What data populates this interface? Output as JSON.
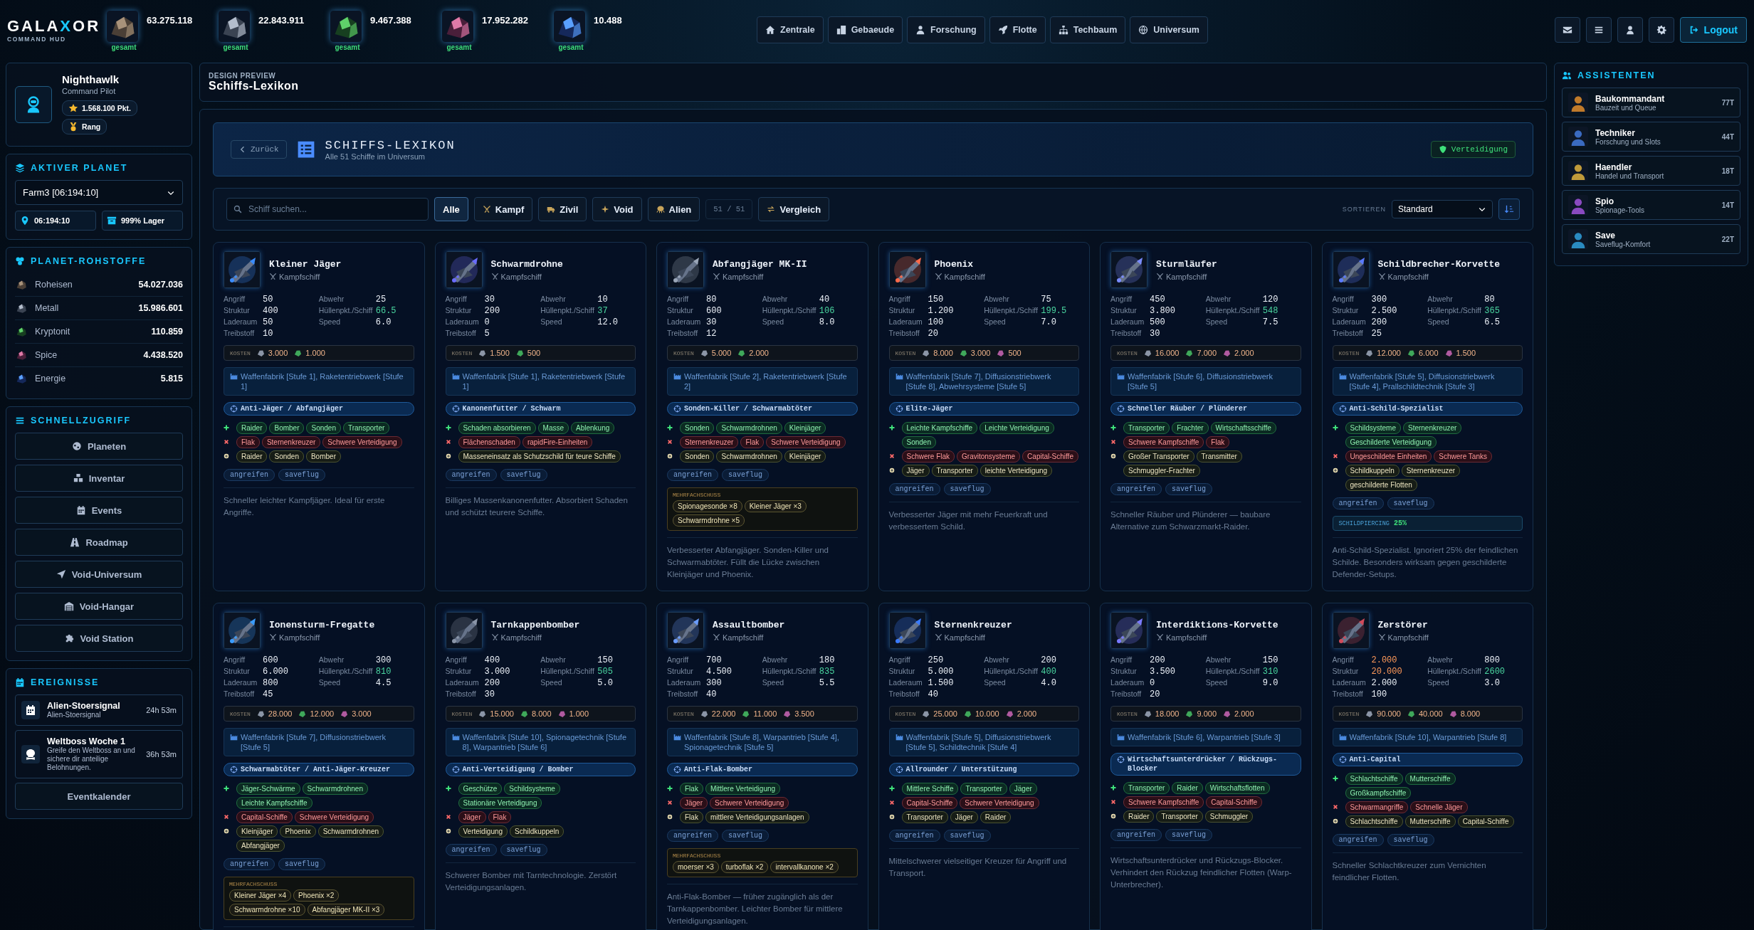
{
  "header": {
    "logo": {
      "before": "GALA",
      "accent": "X",
      "after": "OR",
      "subtitle": "COMMAND HUD"
    },
    "resources": [
      {
        "kind": "roheisen",
        "value": "63.275.118",
        "label": "gesamt"
      },
      {
        "kind": "metall",
        "value": "22.843.911",
        "label": "gesamt"
      },
      {
        "kind": "kryptonit",
        "value": "9.467.388",
        "label": "gesamt"
      },
      {
        "kind": "spice",
        "value": "17.952.282",
        "label": "gesamt"
      },
      {
        "kind": "energie",
        "value": "10.488",
        "label": "gesamt"
      }
    ],
    "nav": [
      "Zentrale",
      "Gebaeude",
      "Forschung",
      "Flotte",
      "Techbaum",
      "Universum"
    ],
    "logout": "Logout"
  },
  "profile": {
    "name": "Nighthawlk",
    "role": "Command Pilot",
    "points": "1.568.100 Pkt.",
    "rank": "Rang"
  },
  "active_planet": {
    "title": "AKTIVER PLANET",
    "selected": "Farm3 [06:194:10]",
    "coords": "06:194:10",
    "storage": "999% Lager"
  },
  "planet_resources": {
    "title": "PLANET-ROHSTOFFE",
    "items": [
      {
        "kind": "roheisen",
        "name": "Roheisen",
        "value": "54.027.036"
      },
      {
        "kind": "metall",
        "name": "Metall",
        "value": "15.986.601"
      },
      {
        "kind": "kryptonit",
        "name": "Kryptonit",
        "value": "110.859"
      },
      {
        "kind": "spice",
        "name": "Spice",
        "value": "4.438.520"
      },
      {
        "kind": "energie",
        "name": "Energie",
        "value": "5.815"
      }
    ]
  },
  "quick_access": {
    "title": "SCHNELLZUGRIFF",
    "items": [
      "Planeten",
      "Inventar",
      "Events",
      "Roadmap",
      "Void-Universum",
      "Void-Hangar",
      "Void Station"
    ]
  },
  "events": {
    "title": "EREIGNISSE",
    "items": [
      {
        "kind": "signal",
        "title": "Alien-Stoersignal",
        "text": "Alien-Stoersignal",
        "time": "24h 53m"
      },
      {
        "kind": "boss",
        "title": "Weltboss Woche 1",
        "text": "Greife den Weltboss an und sichere dir anteilige Belohnungen.",
        "time": "36h 53m"
      }
    ],
    "button": "Eventkalender"
  },
  "page": {
    "eyebrow": "DESIGN PREVIEW",
    "title": "Schiffs-Lexikon"
  },
  "lexikon": {
    "back": "Zurück",
    "title": "SCHIFFS-LEXIKON",
    "subtitle": "Alle 51 Schiffe im Universum",
    "badge": "Verteidigung"
  },
  "filters": {
    "search": {
      "placeholder": "Schiff suchen..."
    },
    "buttons": [
      {
        "label": "Alle",
        "selected": true
      },
      {
        "label": "Kampf",
        "selected": false
      },
      {
        "label": "Zivil",
        "selected": false
      },
      {
        "label": "Void",
        "selected": false
      },
      {
        "label": "Alien",
        "selected": false
      }
    ],
    "count": "51 / 51",
    "compare": "Vergleich",
    "sort_label": "SORTIEREN",
    "sort": "Standard"
  },
  "ships": [
    {
      "name": "Kleiner Jäger",
      "type": "Kampfschiff",
      "stats": [
        {
          "label": "Angriff",
          "value": "50"
        },
        {
          "label": "Abwehr",
          "value": "25"
        },
        {
          "label": "Struktur",
          "value": "400"
        },
        {
          "label": "Hüllenpkt./Schiff",
          "value": "66.5",
          "kind": "hull"
        },
        {
          "label": "Laderaum",
          "value": "50"
        },
        {
          "label": "Speed",
          "value": "6.0"
        },
        {
          "label": "Treibstoff",
          "value": "10"
        }
      ],
      "cost_label": "KOSTEN",
      "costs": [
        {
          "kind": "ore",
          "value": "3.000"
        },
        {
          "kind": "crystal",
          "value": "1.000"
        }
      ],
      "requirement": "Waffenfabrik [Stufe 1], Raketentriebwerk [Stufe 1]",
      "role": "Anti-Jäger / Abfangjäger",
      "matchups": [
        {
          "kind": "strong",
          "tags": [
            "Raider",
            "Bomber",
            "Sonden",
            "Transporter"
          ]
        },
        {
          "kind": "weak",
          "tags": [
            "Flak",
            "Sternenkreuzer",
            "Schwere Verteidigung"
          ]
        },
        {
          "kind": "target",
          "tags": [
            "Raider",
            "Sonden",
            "Bomber"
          ]
        }
      ],
      "missions": [
        "angreifen",
        "saveflug"
      ],
      "description": "Schneller leichter Kampfjäger. Ideal für erste Angriffe."
    },
    {
      "name": "Schwarmdrohne",
      "type": "Kampfschiff",
      "stats": [
        {
          "label": "Angriff",
          "value": "30"
        },
        {
          "label": "Abwehr",
          "value": "10"
        },
        {
          "label": "Struktur",
          "value": "200"
        },
        {
          "label": "Hüllenpkt./Schiff",
          "value": "37",
          "kind": "hull"
        },
        {
          "label": "Laderaum",
          "value": "0"
        },
        {
          "label": "Speed",
          "value": "12.0"
        },
        {
          "label": "Treibstoff",
          "value": "5"
        }
      ],
      "cost_label": "KOSTEN",
      "costs": [
        {
          "kind": "ore",
          "value": "1.500"
        },
        {
          "kind": "crystal",
          "value": "500"
        }
      ],
      "requirement": "Waffenfabrik [Stufe 1], Raketentriebwerk [Stufe 1]",
      "role": "Kanonenfutter / Schwarm",
      "matchups": [
        {
          "kind": "strong",
          "tags": [
            "Schaden absorbieren",
            "Masse",
            "Ablenkung"
          ]
        },
        {
          "kind": "weak",
          "tags": [
            "Flächenschaden",
            "rapidFire-Einheiten"
          ]
        },
        {
          "kind": "target",
          "tags": [
            "Masseneinsatz als Schutzschild für teure Schiffe"
          ]
        }
      ],
      "missions": [
        "angreifen",
        "saveflug"
      ],
      "description": "Billiges Massenkanonenfutter. Absorbiert Schaden und schützt teurere Schiffe."
    },
    {
      "name": "Abfangjäger MK-II",
      "type": "Kampfschiff",
      "stats": [
        {
          "label": "Angriff",
          "value": "80"
        },
        {
          "label": "Abwehr",
          "value": "40"
        },
        {
          "label": "Struktur",
          "value": "600"
        },
        {
          "label": "Hüllenpkt./Schiff",
          "value": "106",
          "kind": "hull"
        },
        {
          "label": "Laderaum",
          "value": "30"
        },
        {
          "label": "Speed",
          "value": "8.0"
        },
        {
          "label": "Treibstoff",
          "value": "12"
        }
      ],
      "cost_label": "KOSTEN",
      "costs": [
        {
          "kind": "ore",
          "value": "5.000"
        },
        {
          "kind": "crystal",
          "value": "2.000"
        }
      ],
      "requirement": "Waffenfabrik [Stufe 2], Raketentriebwerk [Stufe 2]",
      "role": "Sonden-Killer / Schwarmabtöter",
      "matchups": [
        {
          "kind": "strong",
          "tags": [
            "Sonden",
            "Schwarmdrohnen",
            "Kleinjäger"
          ]
        },
        {
          "kind": "weak",
          "tags": [
            "Sternenkreuzer",
            "Flak",
            "Schwere Verteidigung"
          ]
        },
        {
          "kind": "target",
          "tags": [
            "Sonden",
            "Schwarmdrohnen",
            "Kleinjäger"
          ]
        }
      ],
      "missions": [
        "angreifen",
        "saveflug"
      ],
      "multishot": {
        "label": "MEHRFACHSCHUSS",
        "items": [
          "Spionagesonde ×8",
          "Kleiner Jäger ×3",
          "Schwarmdrohne ×5"
        ]
      },
      "description": "Verbesserter Abfangjäger. Sonden-Killer und Schwarmabtöter. Füllt die Lücke zwischen Kleinjäger und Phoenix."
    },
    {
      "name": "Phoenix",
      "type": "Kampfschiff",
      "stats": [
        {
          "label": "Angriff",
          "value": "150"
        },
        {
          "label": "Abwehr",
          "value": "75"
        },
        {
          "label": "Struktur",
          "value": "1.200"
        },
        {
          "label": "Hüllenpkt./Schiff",
          "value": "199.5",
          "kind": "hull"
        },
        {
          "label": "Laderaum",
          "value": "100"
        },
        {
          "label": "Speed",
          "value": "7.0"
        },
        {
          "label": "Treibstoff",
          "value": "20"
        }
      ],
      "cost_label": "KOSTEN",
      "costs": [
        {
          "kind": "ore",
          "value": "8.000"
        },
        {
          "kind": "crystal",
          "value": "3.000"
        },
        {
          "kind": "spice",
          "value": "500"
        }
      ],
      "requirement": "Waffenfabrik [Stufe 7], Diffusionstriebwerk [Stufe 8], Abwehrsysteme [Stufe 5]",
      "role": "Elite-Jäger",
      "matchups": [
        {
          "kind": "strong",
          "tags": [
            "Leichte Kampfschiffe",
            "Leichte Verteidigung",
            "Sonden"
          ]
        },
        {
          "kind": "weak",
          "tags": [
            "Schwere Flak",
            "Gravitonsysteme",
            "Capital-Schiffe"
          ]
        },
        {
          "kind": "target",
          "tags": [
            "Jäger",
            "Transporter",
            "leichte Verteidigung"
          ]
        }
      ],
      "missions": [
        "angreifen",
        "saveflug"
      ],
      "description": "Verbesserter Jäger mit mehr Feuerkraft und verbessertem Schild."
    },
    {
      "name": "Sturmläufer",
      "type": "Kampfschiff",
      "stats": [
        {
          "label": "Angriff",
          "value": "450"
        },
        {
          "label": "Abwehr",
          "value": "120"
        },
        {
          "label": "Struktur",
          "value": "3.800"
        },
        {
          "label": "Hüllenpkt./Schiff",
          "value": "548",
          "kind": "hull"
        },
        {
          "label": "Laderaum",
          "value": "500"
        },
        {
          "label": "Speed",
          "value": "7.5"
        },
        {
          "label": "Treibstoff",
          "value": "30"
        }
      ],
      "cost_label": "KOSTEN",
      "costs": [
        {
          "kind": "ore",
          "value": "16.000"
        },
        {
          "kind": "crystal",
          "value": "7.000"
        },
        {
          "kind": "spice",
          "value": "2.000"
        }
      ],
      "requirement": "Waffenfabrik [Stufe 6], Diffusionstriebwerk [Stufe 5]",
      "role": "Schneller Räuber / Plünderer",
      "matchups": [
        {
          "kind": "strong",
          "tags": [
            "Transporter",
            "Frachter",
            "Wirtschaftsschiffe"
          ]
        },
        {
          "kind": "weak",
          "tags": [
            "Schwere Kampfschiffe",
            "Flak"
          ]
        },
        {
          "kind": "target",
          "tags": [
            "Großer Transporter",
            "Transmitter",
            "Schmuggler-Frachter"
          ]
        }
      ],
      "missions": [
        "angreifen",
        "saveflug"
      ],
      "description": "Schneller Räuber und Plünderer — baubare Alternative zum Schwarzmarkt-Raider."
    },
    {
      "name": "Schildbrecher-Korvette",
      "type": "Kampfschiff",
      "stats": [
        {
          "label": "Angriff",
          "value": "300"
        },
        {
          "label": "Abwehr",
          "value": "80"
        },
        {
          "label": "Struktur",
          "value": "2.500"
        },
        {
          "label": "Hüllenpkt./Schiff",
          "value": "365",
          "kind": "hull"
        },
        {
          "label": "Laderaum",
          "value": "200"
        },
        {
          "label": "Speed",
          "value": "6.5"
        },
        {
          "label": "Treibstoff",
          "value": "25"
        }
      ],
      "cost_label": "KOSTEN",
      "costs": [
        {
          "kind": "ore",
          "value": "12.000"
        },
        {
          "kind": "crystal",
          "value": "6.000"
        },
        {
          "kind": "spice",
          "value": "1.500"
        }
      ],
      "requirement": "Waffenfabrik [Stufe 5], Diffusionstriebwerk [Stufe 4], Prallschildtechnik [Stufe 3]",
      "role": "Anti-Schild-Spezialist",
      "matchups": [
        {
          "kind": "strong",
          "tags": [
            "Schildsysteme",
            "Sternenkreuzer",
            "Geschilderte Verteidigung"
          ]
        },
        {
          "kind": "weak",
          "tags": [
            "Ungeschildete Einheiten",
            "Schwere Tanks"
          ]
        },
        {
          "kind": "target",
          "tags": [
            "Schildkuppeln",
            "Sternenkreuzer",
            "geschilderte Flotten"
          ]
        }
      ],
      "missions": [
        "angreifen",
        "saveflug"
      ],
      "piercing": {
        "label": "SCHILDPIERCING",
        "value": "25%"
      },
      "description": "Anti-Schild-Spezialist. Ignoriert 25% der feindlichen Schilde. Besonders wirksam gegen geschilderte Defender-Setups."
    },
    {
      "name": "Ionensturm-Fregatte",
      "type": "Kampfschiff",
      "stats": [
        {
          "label": "Angriff",
          "value": "600"
        },
        {
          "label": "Abwehr",
          "value": "300"
        },
        {
          "label": "Struktur",
          "value": "6.000"
        },
        {
          "label": "Hüllenpkt./Schiff",
          "value": "810",
          "kind": "hull"
        },
        {
          "label": "Laderaum",
          "value": "800"
        },
        {
          "label": "Speed",
          "value": "4.5"
        },
        {
          "label": "Treibstoff",
          "value": "45"
        }
      ],
      "cost_label": "KOSTEN",
      "costs": [
        {
          "kind": "ore",
          "value": "28.000"
        },
        {
          "kind": "crystal",
          "value": "12.000"
        },
        {
          "kind": "spice",
          "value": "3.000"
        }
      ],
      "requirement": "Waffenfabrik [Stufe 7], Diffusionstriebwerk [Stufe 5]",
      "role": "Schwarmabtöter / Anti-Jäger-Kreuzer",
      "matchups": [
        {
          "kind": "strong",
          "tags": [
            "Jäger-Schwärme",
            "Schwarmdrohnen",
            "Leichte Kampfschiffe"
          ]
        },
        {
          "kind": "weak",
          "tags": [
            "Capital-Schiffe",
            "Schwere Verteidigung"
          ]
        },
        {
          "kind": "target",
          "tags": [
            "Kleinjäger",
            "Phoenix",
            "Schwarmdrohnen",
            "Abfangjäger"
          ]
        }
      ],
      "missions": [
        "angreifen",
        "saveflug"
      ],
      "multishot": {
        "label": "MEHRFACHSCHUSS",
        "items": [
          "Kleiner Jäger ×4",
          "Phoenix ×2",
          "Schwarmdrohne ×10",
          "Abfangjäger MK-II ×3"
        ]
      }
    },
    {
      "name": "Tarnkappenbomber",
      "type": "Kampfschiff",
      "stats": [
        {
          "label": "Angriff",
          "value": "400"
        },
        {
          "label": "Abwehr",
          "value": "150"
        },
        {
          "label": "Struktur",
          "value": "3.000"
        },
        {
          "label": "Hüllenpkt./Schiff",
          "value": "505",
          "kind": "hull"
        },
        {
          "label": "Laderaum",
          "value": "200"
        },
        {
          "label": "Speed",
          "value": "5.0"
        },
        {
          "label": "Treibstoff",
          "value": "30"
        }
      ],
      "cost_label": "KOSTEN",
      "costs": [
        {
          "kind": "ore",
          "value": "15.000"
        },
        {
          "kind": "crystal",
          "value": "8.000"
        },
        {
          "kind": "spice",
          "value": "1.000"
        }
      ],
      "requirement": "Waffenfabrik [Stufe 10], Spionagetechnik [Stufe 8], Warpantrieb [Stufe 6]",
      "role": "Anti-Verteidigung / Bomber",
      "matchups": [
        {
          "kind": "strong",
          "tags": [
            "Geschütze",
            "Schildsysteme",
            "Stationäre Verteidigung"
          ]
        },
        {
          "kind": "weak",
          "tags": [
            "Jäger",
            "Flak"
          ]
        },
        {
          "kind": "target",
          "tags": [
            "Verteidigung",
            "Schildkuppeln"
          ]
        }
      ],
      "missions": [
        "angreifen",
        "saveflug"
      ],
      "description": "Schwerer Bomber mit Tarntechnologie. Zerstört Verteidigungsanlagen."
    },
    {
      "name": "Assaultbomber",
      "type": "Kampfschiff",
      "stats": [
        {
          "label": "Angriff",
          "value": "700"
        },
        {
          "label": "Abwehr",
          "value": "180"
        },
        {
          "label": "Struktur",
          "value": "4.500"
        },
        {
          "label": "Hüllenpkt./Schiff",
          "value": "835",
          "kind": "hull"
        },
        {
          "label": "Laderaum",
          "value": "300"
        },
        {
          "label": "Speed",
          "value": "5.5"
        },
        {
          "label": "Treibstoff",
          "value": "40"
        }
      ],
      "cost_label": "KOSTEN",
      "costs": [
        {
          "kind": "ore",
          "value": "22.000"
        },
        {
          "kind": "crystal",
          "value": "11.000"
        },
        {
          "kind": "spice",
          "value": "3.500"
        }
      ],
      "requirement": "Waffenfabrik [Stufe 8], Warpantrieb [Stufe 4], Spionagetechnik [Stufe 5]",
      "role": "Anti-Flak-Bomber",
      "matchups": [
        {
          "kind": "strong",
          "tags": [
            "Flak",
            "Mittlere Verteidigung"
          ]
        },
        {
          "kind": "weak",
          "tags": [
            "Jäger",
            "Schwere Verteidigung"
          ]
        },
        {
          "kind": "target",
          "tags": [
            "Flak",
            "mittlere Verteidigungsanlagen"
          ]
        }
      ],
      "missions": [
        "angreifen",
        "saveflug"
      ],
      "multishot": {
        "label": "MEHRFACHSCHUSS",
        "items": [
          "moerser ×3",
          "turboflak ×2",
          "intervallkanone ×2"
        ]
      },
      "description": "Anti-Flak-Bomber — früher zugänglich als der Tarnkappenbomber. Leichter Bomber für mittlere Verteidigungsanlagen."
    },
    {
      "name": "Sternenkreuzer",
      "type": "Kampfschiff",
      "stats": [
        {
          "label": "Angriff",
          "value": "250"
        },
        {
          "label": "Abwehr",
          "value": "200"
        },
        {
          "label": "Struktur",
          "value": "5.000"
        },
        {
          "label": "Hüllenpkt./Schiff",
          "value": "400",
          "kind": "hull"
        },
        {
          "label": "Laderaum",
          "value": "1.500"
        },
        {
          "label": "Speed",
          "value": "4.0"
        },
        {
          "label": "Treibstoff",
          "value": "40"
        }
      ],
      "cost_label": "KOSTEN",
      "costs": [
        {
          "kind": "ore",
          "value": "25.000"
        },
        {
          "kind": "crystal",
          "value": "10.000"
        },
        {
          "kind": "spice",
          "value": "2.000"
        }
      ],
      "requirement": "Waffenfabrik [Stufe 5], Diffusionstriebwerk [Stufe 5], Schildtechnik [Stufe 4]",
      "role": "Allrounder / Unterstützung",
      "matchups": [
        {
          "kind": "strong",
          "tags": [
            "Mittlere Schiffe",
            "Transporter",
            "Jäger"
          ]
        },
        {
          "kind": "weak",
          "tags": [
            "Capital-Schiffe",
            "Schwere Verteidigung"
          ]
        },
        {
          "kind": "target",
          "tags": [
            "Transporter",
            "Jäger",
            "Raider"
          ]
        }
      ],
      "missions": [
        "angreifen",
        "saveflug"
      ],
      "description": "Mittelschwerer vielseitiger Kreuzer für Angriff und Transport."
    },
    {
      "name": "Interdiktions-Korvette",
      "type": "Kampfschiff",
      "stats": [
        {
          "label": "Angriff",
          "value": "200"
        },
        {
          "label": "Abwehr",
          "value": "150"
        },
        {
          "label": "Struktur",
          "value": "3.500"
        },
        {
          "label": "Hüllenpkt./Schiff",
          "value": "310",
          "kind": "hull"
        },
        {
          "label": "Laderaum",
          "value": "0"
        },
        {
          "label": "Speed",
          "value": "9.0"
        },
        {
          "label": "Treibstoff",
          "value": "20"
        }
      ],
      "cost_label": "KOSTEN",
      "costs": [
        {
          "kind": "ore",
          "value": "18.000"
        },
        {
          "kind": "crystal",
          "value": "9.000"
        },
        {
          "kind": "spice",
          "value": "2.000"
        }
      ],
      "requirement": "Waffenfabrik [Stufe 6], Warpantrieb [Stufe 3]",
      "role": "Wirtschaftsunterdrücker / Rückzugs-Blocker",
      "matchups": [
        {
          "kind": "strong",
          "tags": [
            "Transporter",
            "Raider",
            "Wirtschaftsflotten"
          ]
        },
        {
          "kind": "weak",
          "tags": [
            "Schwere Kampfschiffe",
            "Capital-Schiffe"
          ]
        },
        {
          "kind": "target",
          "tags": [
            "Raider",
            "Transporter",
            "Schmuggler"
          ]
        }
      ],
      "missions": [
        "angreifen",
        "saveflug"
      ],
      "description": "Wirtschaftsunterdrücker und Rückzugs-Blocker. Verhindert den Rückzug feindlicher Flotten (Warp-Unterbrecher)."
    },
    {
      "name": "Zerstörer",
      "type": "Kampfschiff",
      "stats": [
        {
          "label": "Angriff",
          "value": "2.000",
          "kind": "high"
        },
        {
          "label": "Abwehr",
          "value": "800"
        },
        {
          "label": "Struktur",
          "value": "20.000",
          "kind": "high"
        },
        {
          "label": "Hüllenpkt./Schiff",
          "value": "2600",
          "kind": "hull"
        },
        {
          "label": "Laderaum",
          "value": "2.000"
        },
        {
          "label": "Speed",
          "value": "3.0"
        },
        {
          "label": "Treibstoff",
          "value": "100"
        }
      ],
      "cost_label": "KOSTEN",
      "costs": [
        {
          "kind": "ore",
          "value": "90.000"
        },
        {
          "kind": "crystal",
          "value": "40.000"
        },
        {
          "kind": "spice",
          "value": "8.000"
        }
      ],
      "requirement": "Waffenfabrik [Stufe 10], Warpantrieb [Stufe 8]",
      "role": "Anti-Capital",
      "matchups": [
        {
          "kind": "strong",
          "tags": [
            "Schlachtschiffe",
            "Mutterschiffe",
            "Großkampfschiffe"
          ]
        },
        {
          "kind": "weak",
          "tags": [
            "Schwarmangriffe",
            "Schnelle Jäger"
          ]
        },
        {
          "kind": "target",
          "tags": [
            "Schlachtschiffe",
            "Mutterschiffe",
            "Capital-Schiffe"
          ]
        }
      ],
      "missions": [
        "angreifen",
        "saveflug"
      ],
      "description": "Schneller Schlachtkreuzer zum Vernichten feindlicher Flotten."
    }
  ],
  "assistants": {
    "title": "ASSISTENTEN",
    "items": [
      {
        "name": "Baukommandant",
        "text": "Bauzeit und Queue",
        "count": "77T"
      },
      {
        "name": "Techniker",
        "text": "Forschung und Slots",
        "count": "44T"
      },
      {
        "name": "Haendler",
        "text": "Handel und Transport",
        "count": "18T"
      },
      {
        "name": "Spio",
        "text": "Spionage-Tools",
        "count": "14T"
      },
      {
        "name": "Save",
        "text": "Saveflug-Komfort",
        "count": "22T"
      }
    ]
  }
}
